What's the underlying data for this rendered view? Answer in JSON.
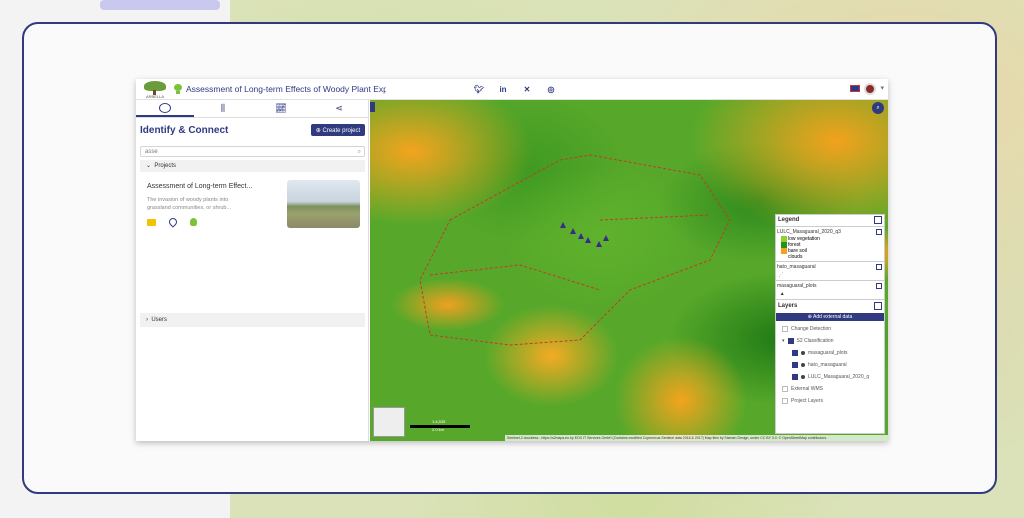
{
  "header": {
    "logo_text": "ARBELLA",
    "title": "Assessment of Long-term Effects of Woody Plant Expansi...",
    "social": [
      "twitter-icon",
      "linkedin-icon",
      "x-icon",
      "instagram-icon"
    ]
  },
  "sidebar": {
    "tabs": [
      "chat-icon",
      "filter-icon",
      "chart-icon",
      "share-icon"
    ],
    "heading": "Identify & Connect",
    "create_button": "⊕ Create project",
    "search_value": "asse",
    "projects_label": "Projects",
    "project_card": {
      "title": "Assessment of Long-term Effect...",
      "description": "The invasion of woody plants into grassland communities, or shrub..."
    },
    "users_label": "Users"
  },
  "map": {
    "scale_labels": [
      "1:4,535",
      "2.0 km"
    ],
    "attribution": "Sentinel-2 cloudless - https://s2maps.eu by EOX IT Services GmbH (Contains modified Copernicus Sentinel data 2016 & 2017) Map tiles by Stamen Design, under CC BY 3.0. © OpenStreetMap contributors.",
    "colors": {
      "orange": "#f3a41e",
      "green": "#57a82a",
      "dark_green": "#1f7a15",
      "accent": "#2f3a80"
    }
  },
  "legend": {
    "title": "Legend",
    "lulc_title": "LULC_Masaguaral_2020_q3",
    "classes": [
      {
        "label": "low vegetation",
        "color": "#8fd12f"
      },
      {
        "label": "forest",
        "color": "#2d8f1a"
      },
      {
        "label": "bare soil",
        "color": "#f3a41e"
      },
      {
        "label": "clouds",
        "color": "#ffffff"
      }
    ],
    "hato_title": "hato_masaguaral",
    "plots_title": "masaguaral_plots",
    "layers_title": "Layers",
    "add_external": "⊕ Add external data",
    "layers": [
      "Change Detection",
      "S2 Classification",
      "masaguaral_plots",
      "hato_masaguaral",
      "LULC_Masaguaral_2020_q",
      "External WMS",
      "Project Layers"
    ]
  }
}
